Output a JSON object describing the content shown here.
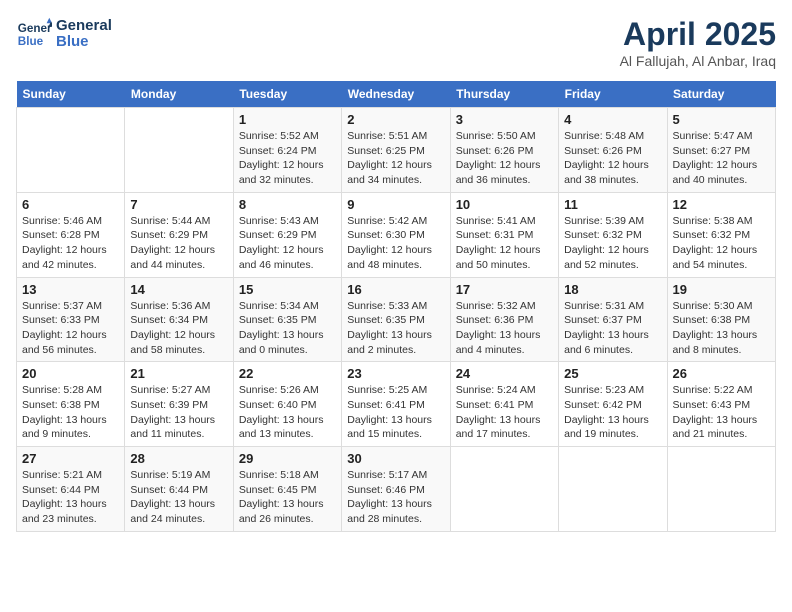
{
  "header": {
    "logo_line1": "General",
    "logo_line2": "Blue",
    "month_year": "April 2025",
    "location": "Al Fallujah, Al Anbar, Iraq"
  },
  "weekdays": [
    "Sunday",
    "Monday",
    "Tuesday",
    "Wednesday",
    "Thursday",
    "Friday",
    "Saturday"
  ],
  "weeks": [
    [
      {
        "day": "",
        "sunrise": "",
        "sunset": "",
        "daylight": ""
      },
      {
        "day": "",
        "sunrise": "",
        "sunset": "",
        "daylight": ""
      },
      {
        "day": "1",
        "sunrise": "Sunrise: 5:52 AM",
        "sunset": "Sunset: 6:24 PM",
        "daylight": "Daylight: 12 hours and 32 minutes."
      },
      {
        "day": "2",
        "sunrise": "Sunrise: 5:51 AM",
        "sunset": "Sunset: 6:25 PM",
        "daylight": "Daylight: 12 hours and 34 minutes."
      },
      {
        "day": "3",
        "sunrise": "Sunrise: 5:50 AM",
        "sunset": "Sunset: 6:26 PM",
        "daylight": "Daylight: 12 hours and 36 minutes."
      },
      {
        "day": "4",
        "sunrise": "Sunrise: 5:48 AM",
        "sunset": "Sunset: 6:26 PM",
        "daylight": "Daylight: 12 hours and 38 minutes."
      },
      {
        "day": "5",
        "sunrise": "Sunrise: 5:47 AM",
        "sunset": "Sunset: 6:27 PM",
        "daylight": "Daylight: 12 hours and 40 minutes."
      }
    ],
    [
      {
        "day": "6",
        "sunrise": "Sunrise: 5:46 AM",
        "sunset": "Sunset: 6:28 PM",
        "daylight": "Daylight: 12 hours and 42 minutes."
      },
      {
        "day": "7",
        "sunrise": "Sunrise: 5:44 AM",
        "sunset": "Sunset: 6:29 PM",
        "daylight": "Daylight: 12 hours and 44 minutes."
      },
      {
        "day": "8",
        "sunrise": "Sunrise: 5:43 AM",
        "sunset": "Sunset: 6:29 PM",
        "daylight": "Daylight: 12 hours and 46 minutes."
      },
      {
        "day": "9",
        "sunrise": "Sunrise: 5:42 AM",
        "sunset": "Sunset: 6:30 PM",
        "daylight": "Daylight: 12 hours and 48 minutes."
      },
      {
        "day": "10",
        "sunrise": "Sunrise: 5:41 AM",
        "sunset": "Sunset: 6:31 PM",
        "daylight": "Daylight: 12 hours and 50 minutes."
      },
      {
        "day": "11",
        "sunrise": "Sunrise: 5:39 AM",
        "sunset": "Sunset: 6:32 PM",
        "daylight": "Daylight: 12 hours and 52 minutes."
      },
      {
        "day": "12",
        "sunrise": "Sunrise: 5:38 AM",
        "sunset": "Sunset: 6:32 PM",
        "daylight": "Daylight: 12 hours and 54 minutes."
      }
    ],
    [
      {
        "day": "13",
        "sunrise": "Sunrise: 5:37 AM",
        "sunset": "Sunset: 6:33 PM",
        "daylight": "Daylight: 12 hours and 56 minutes."
      },
      {
        "day": "14",
        "sunrise": "Sunrise: 5:36 AM",
        "sunset": "Sunset: 6:34 PM",
        "daylight": "Daylight: 12 hours and 58 minutes."
      },
      {
        "day": "15",
        "sunrise": "Sunrise: 5:34 AM",
        "sunset": "Sunset: 6:35 PM",
        "daylight": "Daylight: 13 hours and 0 minutes."
      },
      {
        "day": "16",
        "sunrise": "Sunrise: 5:33 AM",
        "sunset": "Sunset: 6:35 PM",
        "daylight": "Daylight: 13 hours and 2 minutes."
      },
      {
        "day": "17",
        "sunrise": "Sunrise: 5:32 AM",
        "sunset": "Sunset: 6:36 PM",
        "daylight": "Daylight: 13 hours and 4 minutes."
      },
      {
        "day": "18",
        "sunrise": "Sunrise: 5:31 AM",
        "sunset": "Sunset: 6:37 PM",
        "daylight": "Daylight: 13 hours and 6 minutes."
      },
      {
        "day": "19",
        "sunrise": "Sunrise: 5:30 AM",
        "sunset": "Sunset: 6:38 PM",
        "daylight": "Daylight: 13 hours and 8 minutes."
      }
    ],
    [
      {
        "day": "20",
        "sunrise": "Sunrise: 5:28 AM",
        "sunset": "Sunset: 6:38 PM",
        "daylight": "Daylight: 13 hours and 9 minutes."
      },
      {
        "day": "21",
        "sunrise": "Sunrise: 5:27 AM",
        "sunset": "Sunset: 6:39 PM",
        "daylight": "Daylight: 13 hours and 11 minutes."
      },
      {
        "day": "22",
        "sunrise": "Sunrise: 5:26 AM",
        "sunset": "Sunset: 6:40 PM",
        "daylight": "Daylight: 13 hours and 13 minutes."
      },
      {
        "day": "23",
        "sunrise": "Sunrise: 5:25 AM",
        "sunset": "Sunset: 6:41 PM",
        "daylight": "Daylight: 13 hours and 15 minutes."
      },
      {
        "day": "24",
        "sunrise": "Sunrise: 5:24 AM",
        "sunset": "Sunset: 6:41 PM",
        "daylight": "Daylight: 13 hours and 17 minutes."
      },
      {
        "day": "25",
        "sunrise": "Sunrise: 5:23 AM",
        "sunset": "Sunset: 6:42 PM",
        "daylight": "Daylight: 13 hours and 19 minutes."
      },
      {
        "day": "26",
        "sunrise": "Sunrise: 5:22 AM",
        "sunset": "Sunset: 6:43 PM",
        "daylight": "Daylight: 13 hours and 21 minutes."
      }
    ],
    [
      {
        "day": "27",
        "sunrise": "Sunrise: 5:21 AM",
        "sunset": "Sunset: 6:44 PM",
        "daylight": "Daylight: 13 hours and 23 minutes."
      },
      {
        "day": "28",
        "sunrise": "Sunrise: 5:19 AM",
        "sunset": "Sunset: 6:44 PM",
        "daylight": "Daylight: 13 hours and 24 minutes."
      },
      {
        "day": "29",
        "sunrise": "Sunrise: 5:18 AM",
        "sunset": "Sunset: 6:45 PM",
        "daylight": "Daylight: 13 hours and 26 minutes."
      },
      {
        "day": "30",
        "sunrise": "Sunrise: 5:17 AM",
        "sunset": "Sunset: 6:46 PM",
        "daylight": "Daylight: 13 hours and 28 minutes."
      },
      {
        "day": "",
        "sunrise": "",
        "sunset": "",
        "daylight": ""
      },
      {
        "day": "",
        "sunrise": "",
        "sunset": "",
        "daylight": ""
      },
      {
        "day": "",
        "sunrise": "",
        "sunset": "",
        "daylight": ""
      }
    ]
  ]
}
